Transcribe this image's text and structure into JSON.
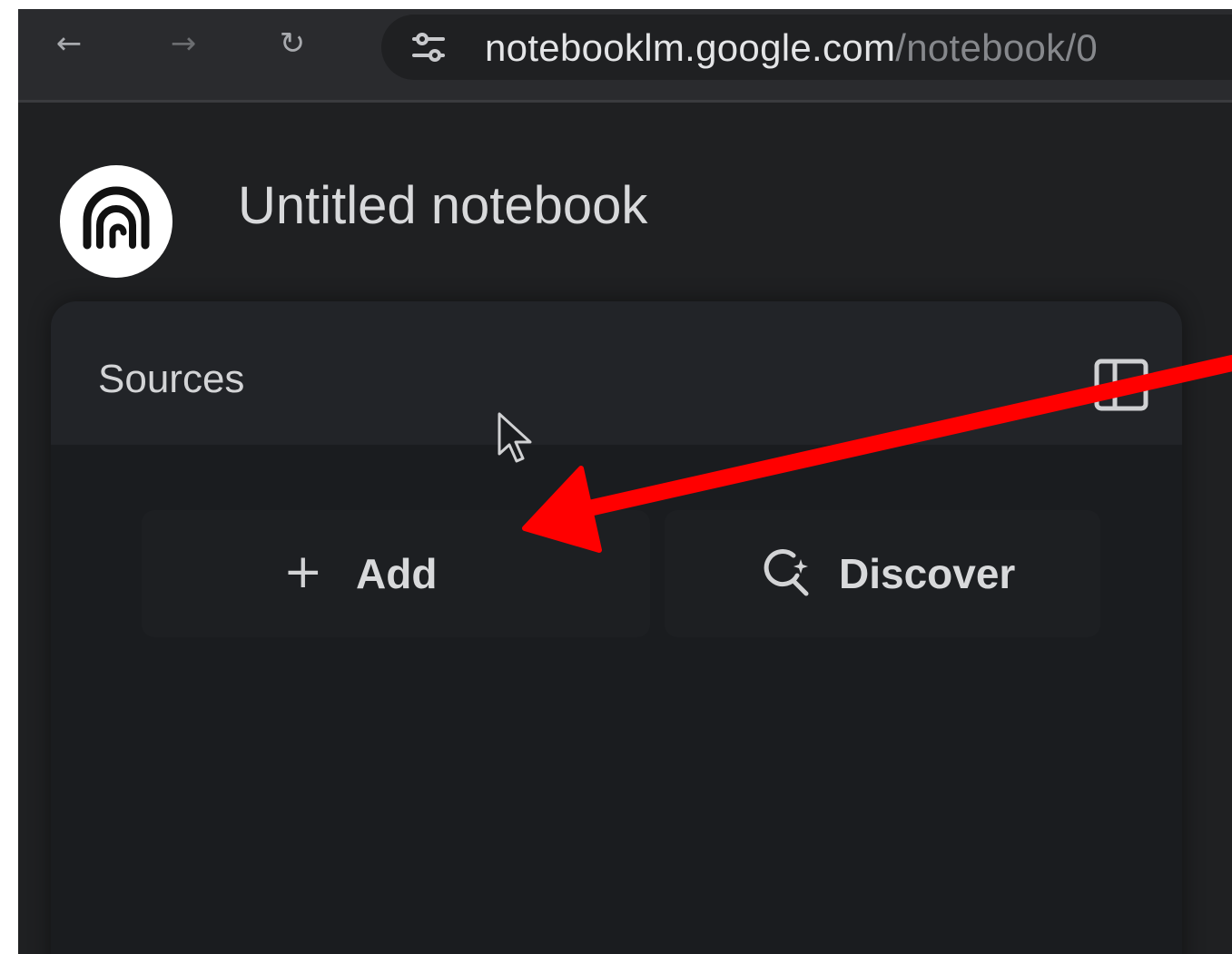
{
  "browser": {
    "url_host": "notebooklm.google.com",
    "url_path": "/notebook/0",
    "back_icon": "arrow-left-icon",
    "forward_icon": "arrow-right-icon",
    "reload_icon": "reload-icon",
    "site_settings_icon": "tune-icon"
  },
  "app": {
    "logo_icon": "notebooklm-logo-icon",
    "notebook_title": "Untitled notebook"
  },
  "sources_panel": {
    "title": "Sources",
    "collapse_icon": "panel-collapse-icon",
    "add_button": {
      "icon": "plus-icon",
      "label": "Add"
    },
    "discover_button": {
      "icon": "search-sparkle-icon",
      "label": "Discover"
    }
  },
  "annotation": {
    "type": "red-arrow",
    "color": "#ff0000",
    "points_to": "add_button"
  }
}
